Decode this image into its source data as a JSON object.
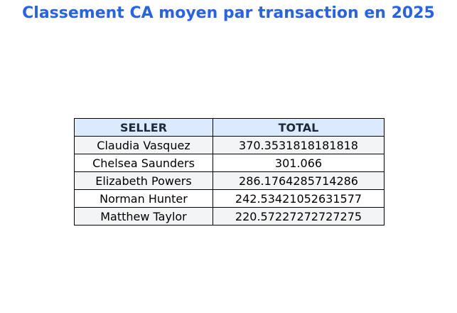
{
  "title": "Classement CA moyen par transaction en 2025",
  "colors": {
    "title": "#2563eb",
    "header_bg": "#dbeafe",
    "header_text": "#1e293b",
    "row_alt_bg": "#f3f4f6",
    "row_bg": "#ffffff",
    "border": "#000000"
  },
  "chart_data": {
    "type": "table",
    "title": "Classement CA moyen par transaction en 2025",
    "columns": [
      "SELLER",
      "TOTAL"
    ],
    "rows": [
      [
        "Claudia Vasquez",
        "370.3531818181818"
      ],
      [
        "Chelsea Saunders",
        "301.066"
      ],
      [
        "Elizabeth Powers",
        "286.1764285714286"
      ],
      [
        "Norman Hunter",
        "242.53421052631577"
      ],
      [
        "Matthew Taylor",
        "220.57227272727275"
      ]
    ]
  }
}
